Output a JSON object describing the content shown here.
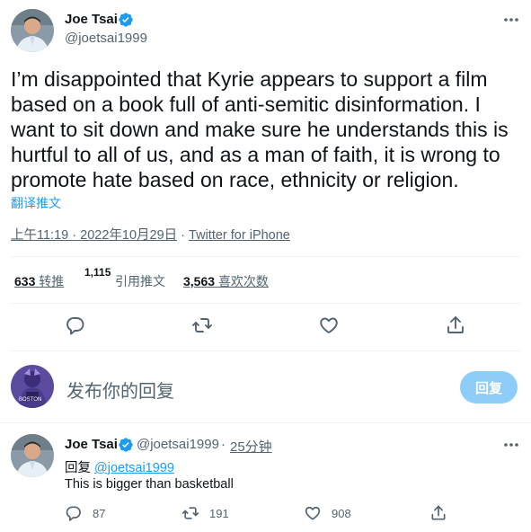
{
  "tweet": {
    "author_name": "Joe Tsai",
    "author_handle": "@joetsai1999",
    "text": "I’m disappointed that Kyrie appears to support a film based on a book full of anti-semitic disinformation. I want to sit down and make sure he understands this is hurtful to all of us, and as a man of faith, it is wrong to promote hate based on race, ethnicity or religion.",
    "translate_label": "翻译推文",
    "time": "上午11:19",
    "separator": "·",
    "date": "2022年10月29日",
    "source": "Twitter for iPhone",
    "retweets_count": "633",
    "retweets_label": "转推",
    "quotes_count_partial": "1,115",
    "quotes_label": "引用推文",
    "likes_count": "3,563",
    "likes_label": "喜欢次数"
  },
  "actions": {
    "icons": [
      "reply-icon",
      "retweet-icon",
      "like-icon",
      "share-icon"
    ]
  },
  "reply_composer": {
    "placeholder": "发布你的回复",
    "button_label": "回复",
    "avatar_caption": "BOSTON"
  },
  "reply": {
    "author_name": "Joe Tsai",
    "author_handle": "@joetsai1999",
    "separator": "·",
    "time_ago": "25分钟",
    "replying_to_label": "回复",
    "replying_to_handle": "@joetsai1999",
    "text": "This is bigger than basketball",
    "reply_count": "87",
    "retweet_count": "191",
    "like_count": "908"
  },
  "colors": {
    "accent": "#1d9bf0",
    "button_disabled": "#8ecdf8",
    "secondary_text": "#536471"
  }
}
